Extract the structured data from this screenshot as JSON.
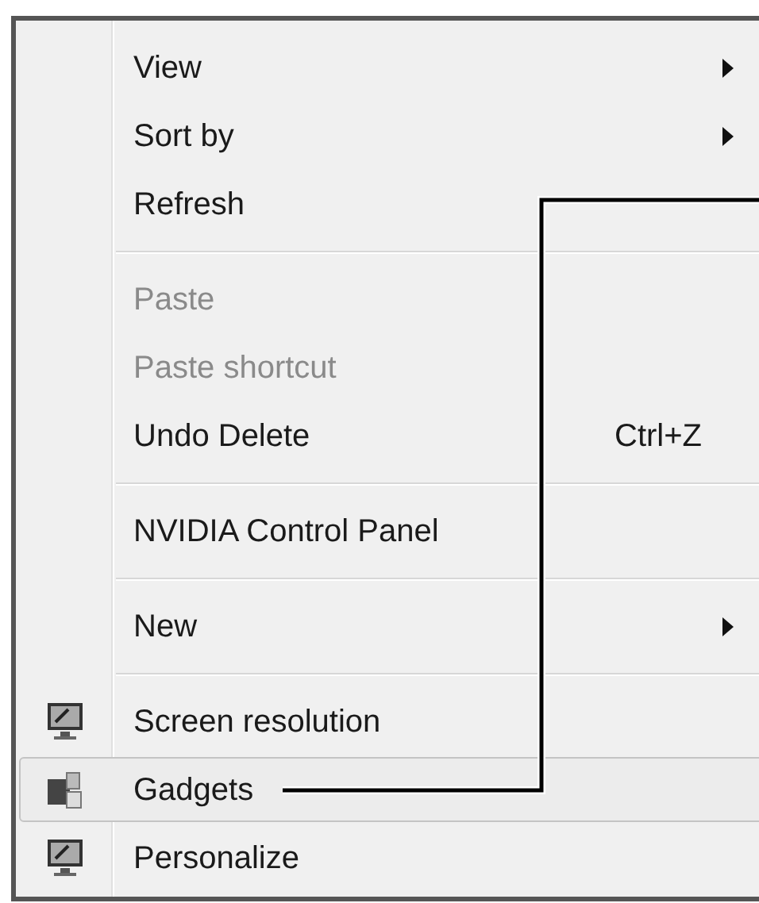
{
  "context_menu": {
    "items": [
      {
        "kind": "item",
        "label": "View",
        "disabled": false,
        "submenu": true,
        "selected": false
      },
      {
        "kind": "item",
        "label": "Sort by",
        "disabled": false,
        "submenu": true,
        "selected": false
      },
      {
        "kind": "item",
        "label": "Refresh",
        "disabled": false,
        "submenu": false,
        "selected": false
      },
      {
        "kind": "separator"
      },
      {
        "kind": "item",
        "label": "Paste",
        "disabled": true,
        "submenu": false,
        "selected": false
      },
      {
        "kind": "item",
        "label": "Paste shortcut",
        "disabled": true,
        "submenu": false,
        "selected": false
      },
      {
        "kind": "item",
        "label": "Undo Delete",
        "shortcut": "Ctrl+Z",
        "disabled": false,
        "submenu": false,
        "selected": false
      },
      {
        "kind": "separator"
      },
      {
        "kind": "item",
        "label": "NVIDIA Control Panel",
        "disabled": false,
        "submenu": false,
        "selected": false
      },
      {
        "kind": "separator"
      },
      {
        "kind": "item",
        "label": "New",
        "disabled": false,
        "submenu": true,
        "selected": false
      },
      {
        "kind": "separator"
      },
      {
        "kind": "item",
        "label": "Screen resolution",
        "disabled": false,
        "submenu": false,
        "selected": false
      },
      {
        "kind": "item",
        "label": "Gadgets",
        "disabled": false,
        "submenu": false,
        "selected": true
      },
      {
        "kind": "item",
        "label": "Personalize",
        "disabled": false,
        "submenu": false,
        "selected": false
      }
    ]
  }
}
